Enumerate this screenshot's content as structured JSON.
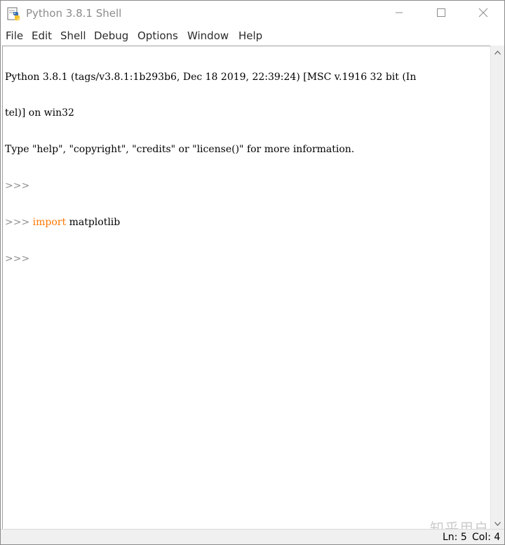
{
  "window": {
    "title": "Python 3.8.1 Shell",
    "icon": "python-idle-icon"
  },
  "window_controls": {
    "minimize": "minimize-icon",
    "maximize": "maximize-icon",
    "close": "close-icon"
  },
  "menu": {
    "items": [
      "File",
      "Edit",
      "Shell",
      "Debug",
      "Options",
      "Window",
      "Help"
    ]
  },
  "shell": {
    "banner_line1": "Python 3.8.1 (tags/v3.8.1:1b293b6, Dec 18 2019, 22:39:24) [MSC v.1916 32 bit (In",
    "banner_line2": "tel)] on win32",
    "banner_line3": "Type \"help\", \"copyright\", \"credits\" or \"license()\" for more information.",
    "prompt": ">>>",
    "command_keyword": "import",
    "command_rest": " matplotlib"
  },
  "status": {
    "ln": "Ln: 5",
    "col": "Col: 4"
  },
  "watermark": "知乎用户",
  "colors": {
    "keyword": "#ff7700",
    "prompt": "#8c8c8c",
    "title_text": "#8c8c8c"
  }
}
